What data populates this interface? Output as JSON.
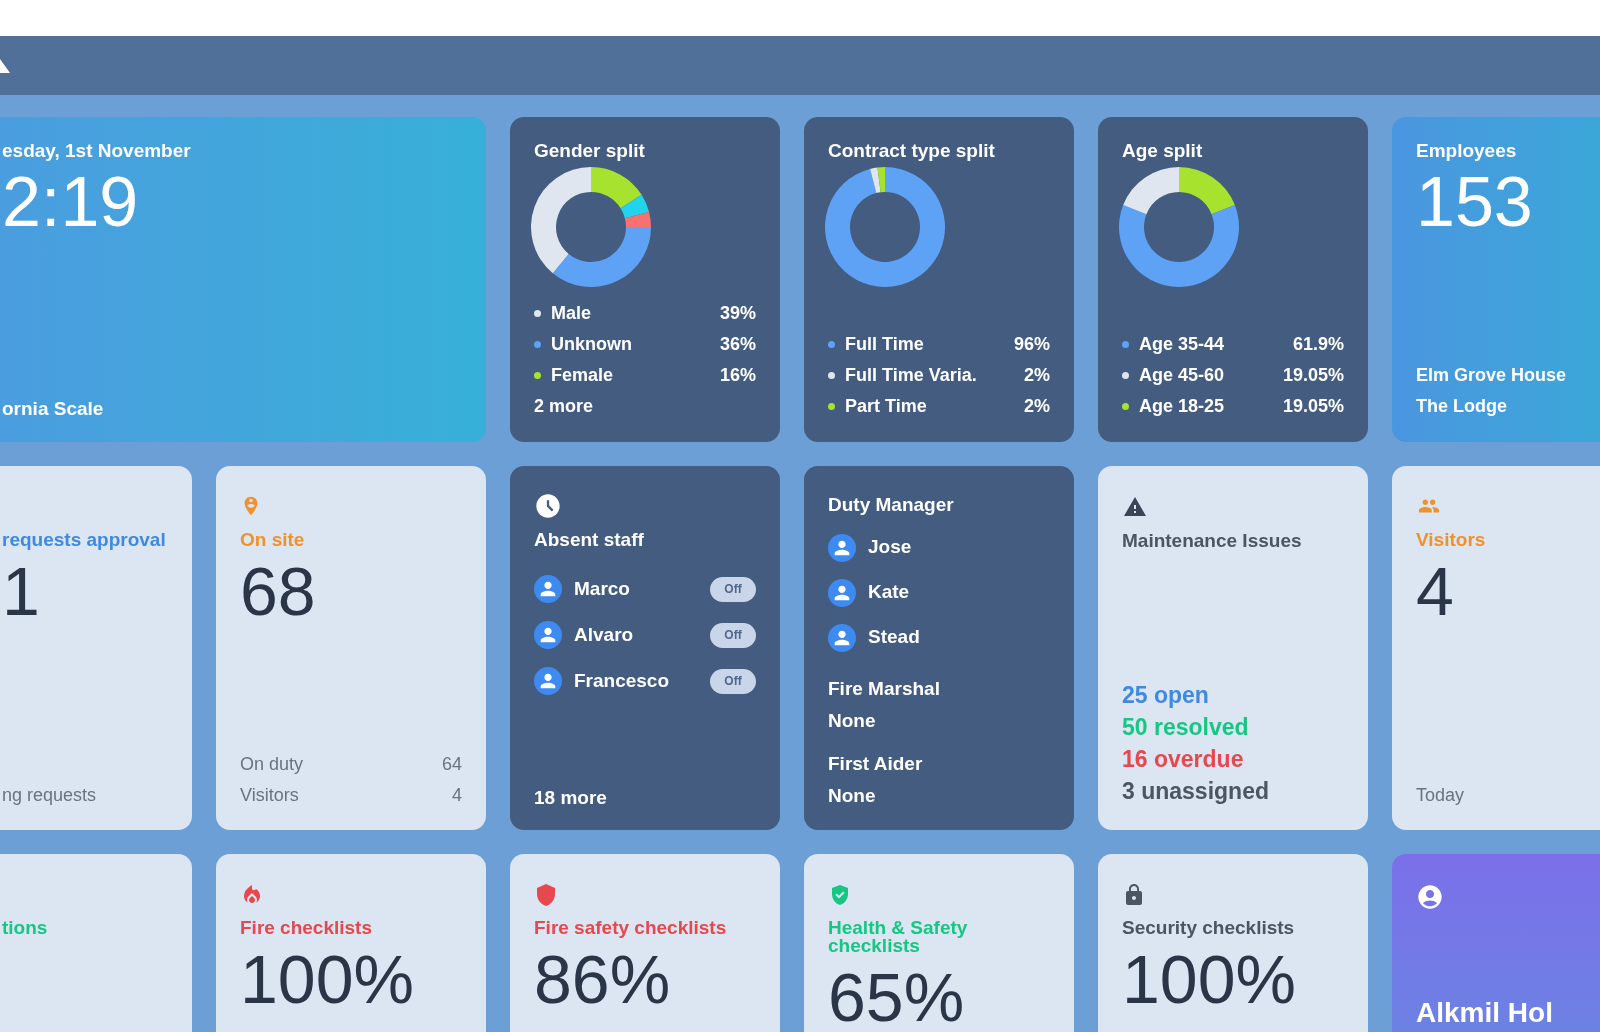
{
  "rows": [
    [
      {
        "kind": "clock",
        "date": "esday, 1st November",
        "time": "2:19",
        "place": "ornia Scale"
      },
      {
        "kind": "donut",
        "title": "Gender split",
        "chart_data": {
          "type": "donut",
          "values": [
            16,
            5,
            4,
            36,
            39
          ]
        },
        "legend": [
          {
            "label": "Male",
            "value": "39%",
            "color": "#dfe6ef"
          },
          {
            "label": "Unknown",
            "value": "36%",
            "color": "#5ea2f5"
          },
          {
            "label": "Female",
            "value": "16%",
            "color": "#a6e22e"
          }
        ],
        "more": "2 more"
      },
      {
        "kind": "donut",
        "title": "Contract type split",
        "chart_data": {
          "type": "donut",
          "values": [
            96,
            2,
            2
          ]
        },
        "legend": [
          {
            "label": "Full Time",
            "value": "96%",
            "color": "#5ea2f5"
          },
          {
            "label": "Full Time Varia.",
            "value": "2%",
            "color": "#dfe6ef"
          },
          {
            "label": "Part Time",
            "value": "2%",
            "color": "#a6e22e"
          }
        ]
      },
      {
        "kind": "donut",
        "title": "Age split",
        "chart_data": {
          "type": "donut",
          "values": [
            19.05,
            61.9,
            19.05
          ]
        },
        "legend": [
          {
            "label": "Age 35-44",
            "value": "61.9%",
            "color": "#5ea2f5"
          },
          {
            "label": "Age 45-60",
            "value": "19.05%",
            "color": "#dfe6ef"
          },
          {
            "label": "Age 18-25",
            "value": "19.05%",
            "color": "#a6e22e"
          }
        ]
      },
      {
        "kind": "total",
        "label": "Employees",
        "count": "153",
        "sites": [
          "Elm Grove House",
          "The Lodge"
        ]
      }
    ],
    [
      {
        "kind": "approvals",
        "label": "requests approval",
        "color": "#3f8ae0",
        "count": "1",
        "footer": "ng requests"
      },
      {
        "kind": "onsite",
        "label": "On site",
        "color": "#f0922b",
        "count": "68",
        "details": [
          {
            "label": "On duty",
            "value": "64"
          },
          {
            "label": "Visitors",
            "value": "4"
          }
        ]
      },
      {
        "kind": "absent",
        "title": "Absent staff",
        "staff": [
          {
            "name": "Marco",
            "status": "Off"
          },
          {
            "name": "Alvaro",
            "status": "Off"
          },
          {
            "name": "Francesco",
            "status": "Off"
          }
        ],
        "more": "18 more"
      },
      {
        "kind": "duty",
        "title": "Duty Manager",
        "managers": [
          {
            "name": "Jose"
          },
          {
            "name": "Kate"
          },
          {
            "name": "Stead"
          }
        ],
        "roles": [
          {
            "title": "Fire Marshal",
            "value": "None"
          },
          {
            "title": "First Aider",
            "value": "None"
          }
        ]
      },
      {
        "kind": "issues",
        "title": "Maintenance Issues",
        "counts": [
          {
            "text": "25 open",
            "color": "#3f8ae0"
          },
          {
            "text": "50 resolved",
            "color": "#16c784"
          },
          {
            "text": "16 overdue",
            "color": "#e5484d"
          },
          {
            "text": "3 unassigned",
            "color": "#4b5563"
          }
        ]
      },
      {
        "kind": "visitors",
        "label": "Visitors",
        "color": "#f0922b",
        "count": "4",
        "footer": "Today"
      }
    ],
    [
      {
        "kind": "checklist",
        "label": "tions",
        "color": "#16c784"
      },
      {
        "kind": "fire",
        "label": "Fire checklists",
        "color": "#e5484d",
        "percent": "100%"
      },
      {
        "kind": "fire-safety",
        "label": "Fire safety checklists",
        "color": "#e5484d",
        "percent": "86%"
      },
      {
        "kind": "health-safety",
        "label": "Health & Safety checklists",
        "color": "#16c784",
        "percent": "65%"
      },
      {
        "kind": "security",
        "label": "Security checklists",
        "color": "#4b5563",
        "percent": "100%"
      },
      {
        "kind": "profile",
        "name": "Alkmil Hol"
      }
    ]
  ]
}
